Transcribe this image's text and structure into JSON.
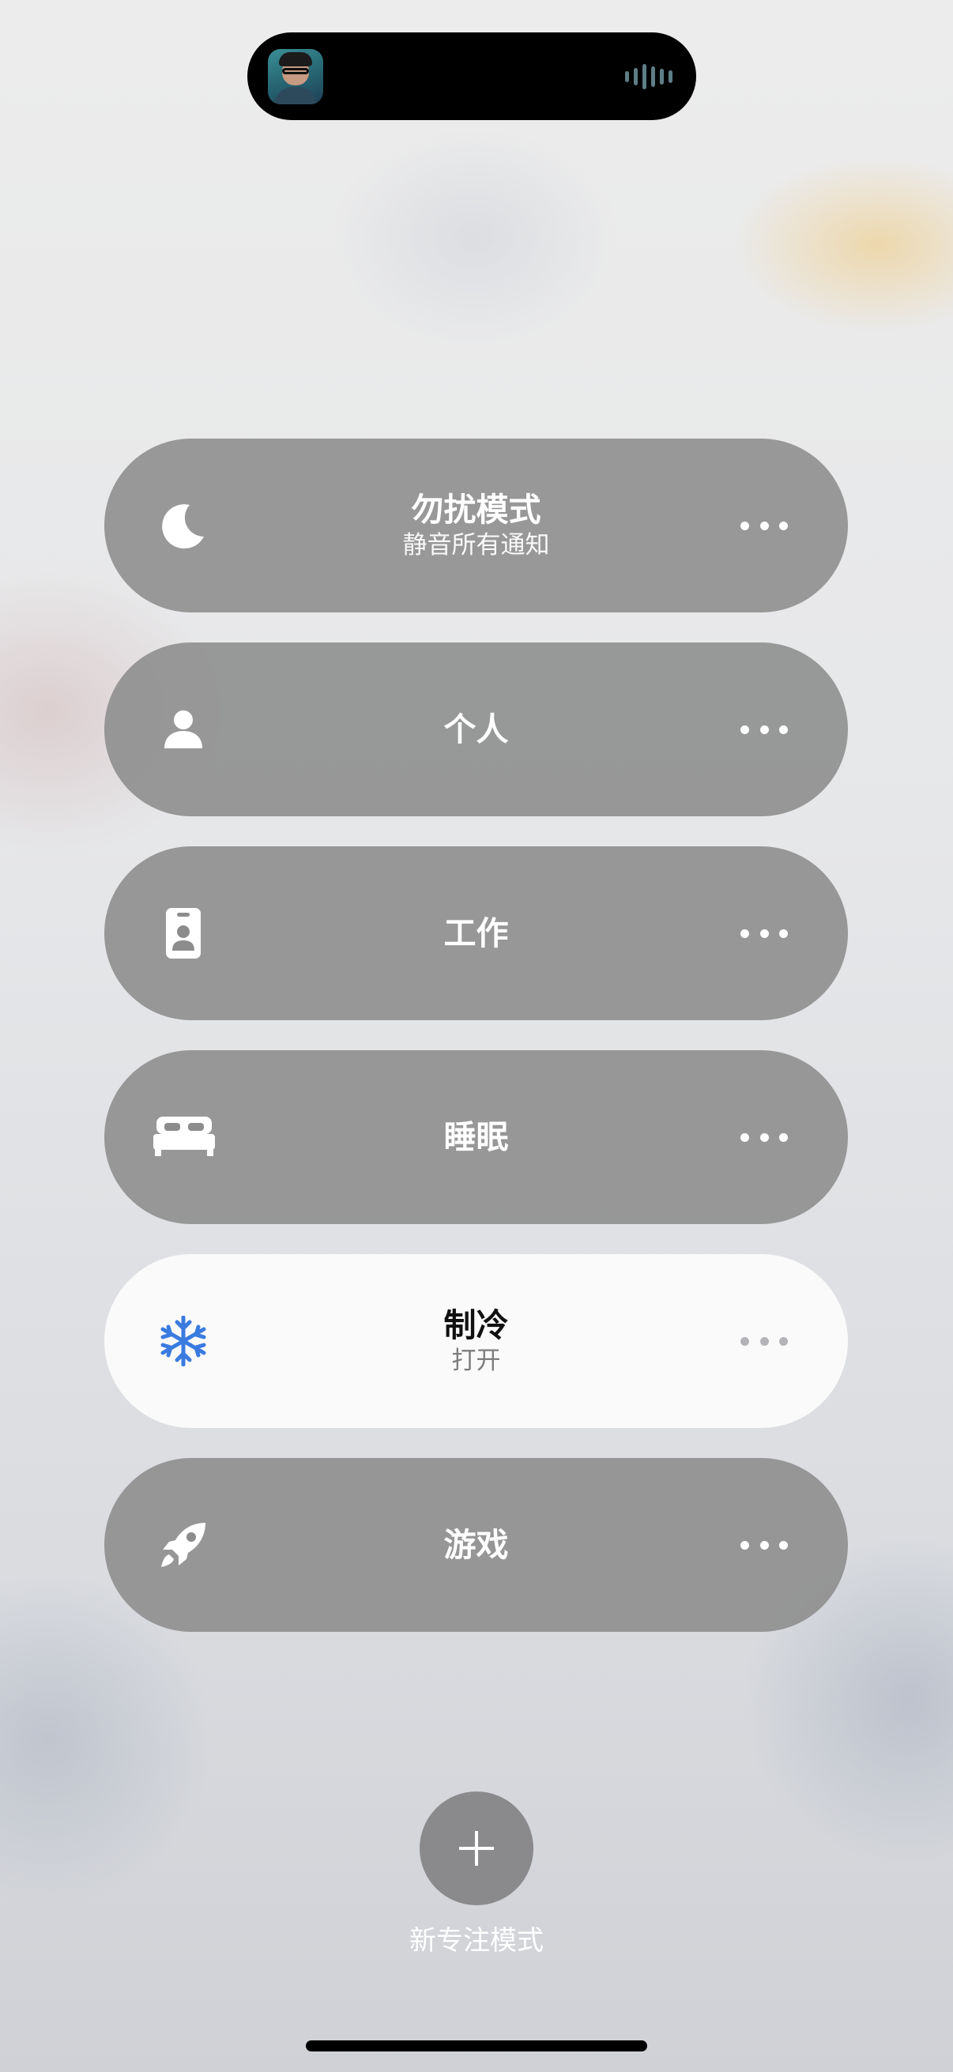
{
  "focus_modes": [
    {
      "title": "勿扰模式",
      "subtitle": "静音所有通知",
      "icon": "moon-icon",
      "active": false
    },
    {
      "title": "个人",
      "subtitle": "",
      "icon": "person-icon",
      "active": false
    },
    {
      "title": "工作",
      "subtitle": "",
      "icon": "id-badge-icon",
      "active": false
    },
    {
      "title": "睡眠",
      "subtitle": "",
      "icon": "bed-icon",
      "active": false
    },
    {
      "title": "制冷",
      "subtitle": "打开",
      "icon": "snowflake-icon",
      "active": true
    },
    {
      "title": "游戏",
      "subtitle": "",
      "icon": "rocket-icon",
      "active": false
    }
  ],
  "add_button": {
    "label": "新专注模式",
    "icon": "plus-icon"
  },
  "colors": {
    "active_icon": "#3a7be0",
    "row_bg": "#8c8c8c",
    "active_row_bg": "#fafafa"
  }
}
